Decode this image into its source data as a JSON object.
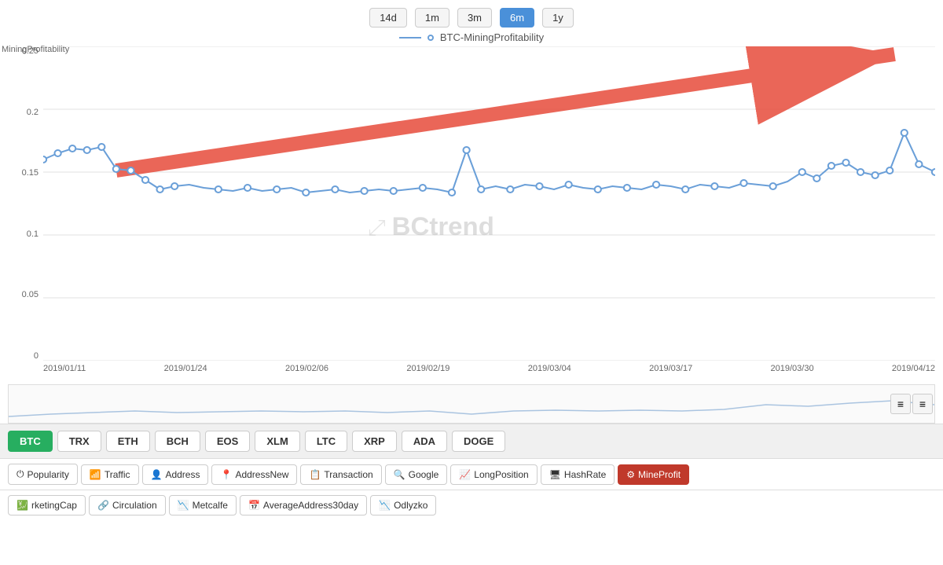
{
  "timeButtons": [
    {
      "label": "14d",
      "active": false
    },
    {
      "label": "1m",
      "active": false
    },
    {
      "label": "3m",
      "active": false
    },
    {
      "label": "6m",
      "active": true
    },
    {
      "label": "1y",
      "active": false
    }
  ],
  "legend": {
    "label": "BTC-MiningProfitability"
  },
  "yAxisLabel": "MiningProfitability",
  "yAxisValues": [
    "0.25",
    "0.2",
    "0.15",
    "0.1",
    "0.05",
    "0"
  ],
  "xAxisValues": [
    "2019/01/11",
    "2019/01/24",
    "2019/02/06",
    "2019/02/19",
    "2019/03/04",
    "2019/03/17",
    "2019/03/30",
    "2019/04/12"
  ],
  "watermark": "BCtrend",
  "miniButtons": [
    "≡",
    "≡"
  ],
  "coins": [
    {
      "label": "BTC",
      "active": true
    },
    {
      "label": "TRX",
      "active": false
    },
    {
      "label": "ETH",
      "active": false
    },
    {
      "label": "BCH",
      "active": false
    },
    {
      "label": "EOS",
      "active": false
    },
    {
      "label": "XLM",
      "active": false
    },
    {
      "label": "LTC",
      "active": false
    },
    {
      "label": "XRP",
      "active": false
    },
    {
      "label": "ADA",
      "active": false
    },
    {
      "label": "DOGE",
      "active": false
    }
  ],
  "metrics": [
    {
      "label": "Popularity",
      "icon": "⏻",
      "active": false
    },
    {
      "label": "Traffic",
      "icon": "📶",
      "active": false
    },
    {
      "label": "Address",
      "icon": "👤",
      "active": false
    },
    {
      "label": "AddressNew",
      "icon": "📍",
      "active": false
    },
    {
      "label": "Transaction",
      "icon": "📋",
      "active": false
    },
    {
      "label": "Google",
      "icon": "🔍",
      "active": false
    },
    {
      "label": "LongPosition",
      "icon": "📈",
      "active": false
    },
    {
      "label": "HashRate",
      "icon": "🖥",
      "active": false
    },
    {
      "label": "MineProfit",
      "icon": "⚙",
      "active": true
    }
  ],
  "bottomTabs": [
    {
      "label": "rketingCap",
      "icon": "💹"
    },
    {
      "label": "Circulation",
      "icon": "🔗"
    },
    {
      "label": "Metcalfe",
      "icon": "📉"
    },
    {
      "label": "AverageAddress30day",
      "icon": "📅"
    },
    {
      "label": "Odlyzko",
      "icon": "📉"
    }
  ]
}
